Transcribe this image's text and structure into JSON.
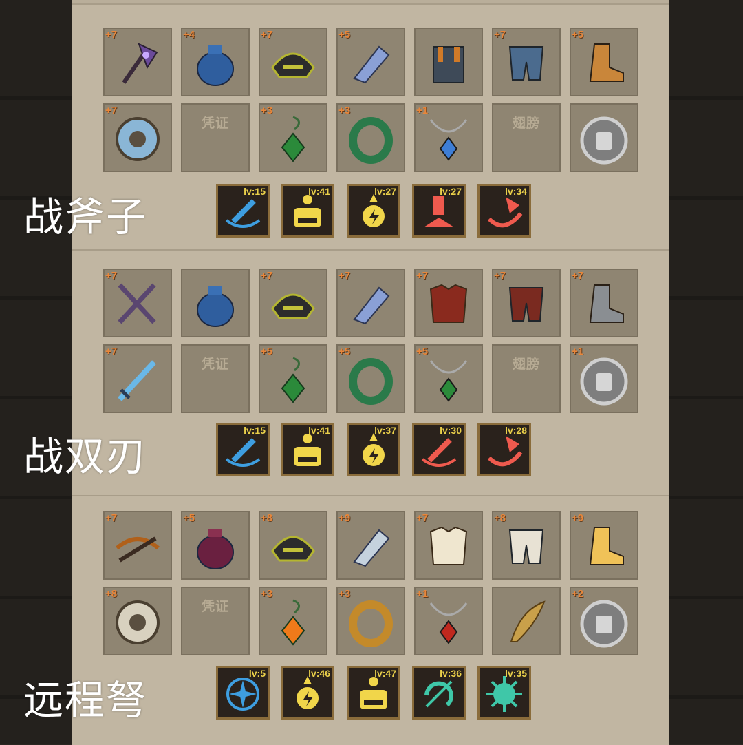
{
  "placeholders": {
    "voucher": "凭证",
    "wings": "翅膀"
  },
  "sections": [
    {
      "class_name": "战斧子",
      "equipment_top": [
        {
          "level": "+7",
          "item": "axe-icon"
        },
        {
          "level": "+4",
          "item": "pouch-icon"
        },
        {
          "level": "+7",
          "item": "horned-helmet-icon"
        },
        {
          "level": "+5",
          "item": "crystal-gauntlet-icon"
        },
        {
          "level": "",
          "item": "overalls-icon"
        },
        {
          "level": "+7",
          "item": "shorts-icon"
        },
        {
          "level": "+5",
          "item": "boot-icon"
        }
      ],
      "equipment_bottom": [
        {
          "level": "+7",
          "item": "eagle-shield-icon"
        },
        {
          "level": "",
          "item": "voucher-placeholder"
        },
        {
          "level": "+3",
          "item": "emerald-earring-icon"
        },
        {
          "level": "+3",
          "item": "vine-ring-icon"
        },
        {
          "level": "+1",
          "item": "sapphire-necklace-icon"
        },
        {
          "level": "",
          "item": "wings-placeholder"
        },
        {
          "level": "",
          "item": "fist-medal-icon"
        }
      ],
      "skills": [
        {
          "level": "lv:15",
          "icon": "sword-slash-skill-icon",
          "color": "#3e9ee0"
        },
        {
          "level": "lv:41",
          "icon": "rage-face-skill-icon",
          "color": "#f1d64a"
        },
        {
          "level": "lv:27",
          "icon": "lightning-fist-skill-icon",
          "color": "#f1d64a"
        },
        {
          "level": "lv:27",
          "icon": "ground-slam-skill-icon",
          "color": "#ef5a4e"
        },
        {
          "level": "lv:34",
          "icon": "axe-whirl-skill-icon",
          "color": "#ef5a4e"
        }
      ]
    },
    {
      "class_name": "战双刃",
      "equipment_top": [
        {
          "level": "+7",
          "item": "twin-blades-icon"
        },
        {
          "level": "",
          "item": "pouch-icon"
        },
        {
          "level": "+7",
          "item": "horned-helmet-icon"
        },
        {
          "level": "+7",
          "item": "claw-glove-icon"
        },
        {
          "level": "+7",
          "item": "lava-armor-icon"
        },
        {
          "level": "+7",
          "item": "lava-leggings-icon"
        },
        {
          "level": "+7",
          "item": "steel-boot-icon"
        }
      ],
      "equipment_bottom": [
        {
          "level": "+7",
          "item": "ice-sword-icon"
        },
        {
          "level": "",
          "item": "voucher-placeholder"
        },
        {
          "level": "+5",
          "item": "emerald-earring-icon"
        },
        {
          "level": "+5",
          "item": "vine-ring-icon"
        },
        {
          "level": "+5",
          "item": "branch-necklace-icon"
        },
        {
          "level": "",
          "item": "wings-placeholder"
        },
        {
          "level": "+1",
          "item": "fist-medal-icon"
        }
      ],
      "skills": [
        {
          "level": "lv:15",
          "icon": "sword-slash-skill-icon",
          "color": "#3e9ee0"
        },
        {
          "level": "lv:41",
          "icon": "rage-face-skill-icon",
          "color": "#f1d64a"
        },
        {
          "level": "lv:37",
          "icon": "lightning-fist-skill-icon",
          "color": "#f1d64a"
        },
        {
          "level": "lv:30",
          "icon": "blade-thrust-skill-icon",
          "color": "#ef5a4e"
        },
        {
          "level": "lv:28",
          "icon": "blade-spin-skill-icon",
          "color": "#ef5a4e"
        }
      ]
    },
    {
      "class_name": "远程弩",
      "equipment_top": [
        {
          "level": "+7",
          "item": "crossbow-icon"
        },
        {
          "level": "+5",
          "item": "skull-pouch-icon"
        },
        {
          "level": "+8",
          "item": "eye-hood-icon"
        },
        {
          "level": "+9",
          "item": "silver-gauntlet-icon"
        },
        {
          "level": "+7",
          "item": "gold-chest-armor-icon"
        },
        {
          "level": "+8",
          "item": "white-skirt-icon"
        },
        {
          "level": "+9",
          "item": "fur-boot-icon"
        }
      ],
      "equipment_bottom": [
        {
          "level": "+8",
          "item": "round-shield-icon"
        },
        {
          "level": "",
          "item": "voucher-placeholder"
        },
        {
          "level": "+3",
          "item": "sun-earring-icon"
        },
        {
          "level": "+3",
          "item": "amber-ring-icon"
        },
        {
          "level": "+1",
          "item": "ruby-necklace-icon"
        },
        {
          "level": "",
          "item": "feather-wing-icon"
        },
        {
          "level": "+2",
          "item": "sword-medal-icon"
        }
      ],
      "skills": [
        {
          "level": "lv:5",
          "icon": "star-burst-skill-icon",
          "color": "#3e9ee0"
        },
        {
          "level": "lv:46",
          "icon": "lightning-fist-skill-icon",
          "color": "#f1d64a"
        },
        {
          "level": "lv:47",
          "icon": "rage-face-skill-icon",
          "color": "#f1d64a"
        },
        {
          "level": "lv:36",
          "icon": "arrow-cycle-skill-icon",
          "color": "#3fc7a8"
        },
        {
          "level": "lv:35",
          "icon": "spiky-orb-skill-icon",
          "color": "#3fc7a8"
        }
      ]
    }
  ]
}
